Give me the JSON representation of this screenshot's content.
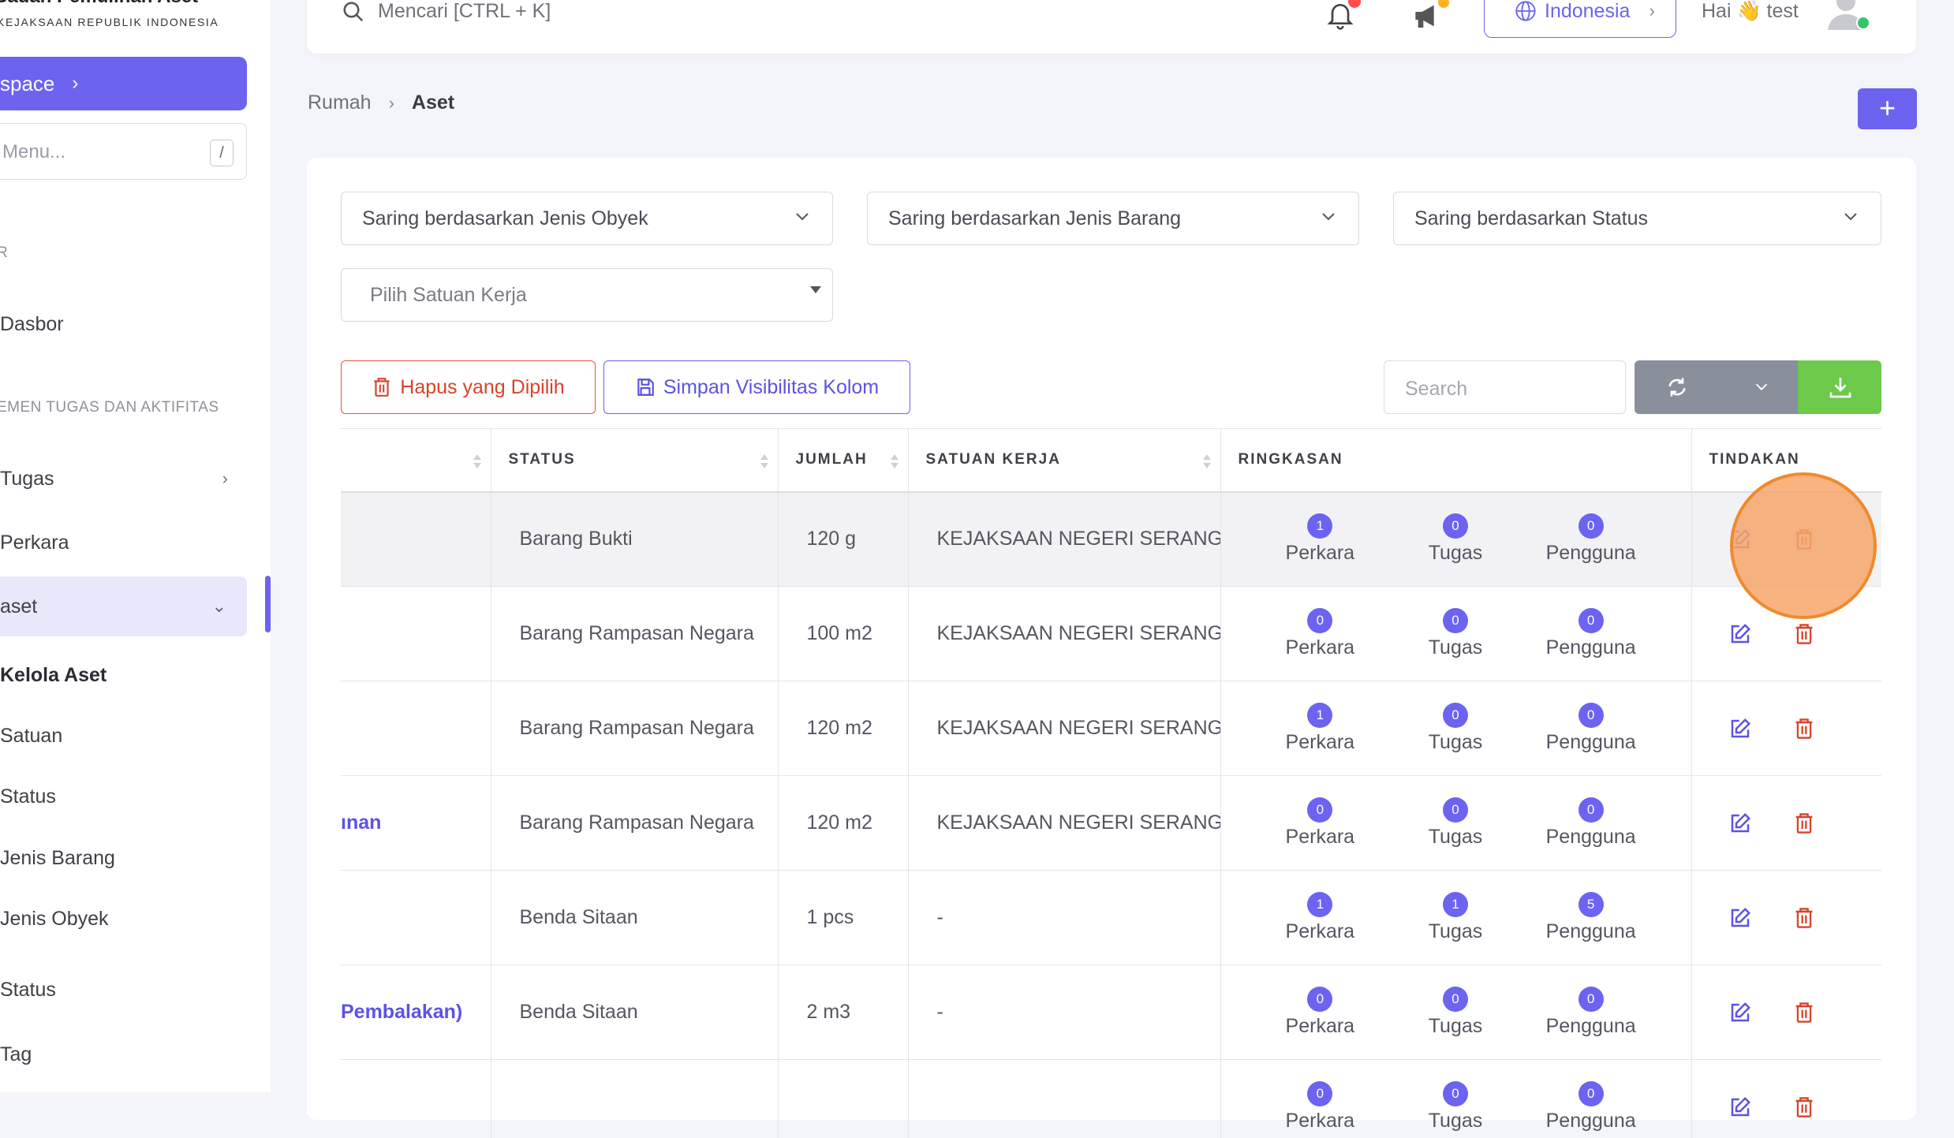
{
  "sidebar": {
    "brand_title": "Badan Pemulihan Aset",
    "brand_sub": "KEJAKSAAN REPUBLIK INDONESIA",
    "workspace_label": "space",
    "menu_search_placeholder": "Menu...",
    "menu_search_shortcut": "/",
    "section_1": "R",
    "section_2": "EMEN TUGAS DAN AKTIFITAS",
    "items": [
      {
        "label": "Dasbor"
      },
      {
        "label": "Tugas"
      },
      {
        "label": "Perkara"
      },
      {
        "label": "aset"
      },
      {
        "label": "Kelola Aset"
      },
      {
        "label": "Satuan"
      },
      {
        "label": "Status"
      },
      {
        "label": "Jenis Barang"
      },
      {
        "label": "Jenis Obyek"
      },
      {
        "label": "Status"
      },
      {
        "label": "Tag"
      }
    ]
  },
  "topbar": {
    "search_placeholder": "Mencari [CTRL + K]",
    "language": "Indonesia",
    "greeting": "Hai 👋 test"
  },
  "breadcrumb": {
    "home": "Rumah",
    "current": "Aset"
  },
  "add_label": "+",
  "filters": {
    "jenis_obyek": "Saring berdasarkan Jenis Obyek",
    "jenis_barang": "Saring berdasarkan Jenis Barang",
    "status": "Saring berdasarkan Status",
    "satuan_kerja": "Pilih Satuan Kerja"
  },
  "toolbar": {
    "delete_selected": "Hapus yang Dipilih",
    "save_columns": "Simpan Visibilitas Kolom",
    "search_placeholder": "Search"
  },
  "table": {
    "headers": {
      "status": "STATUS",
      "jumlah": "JUMLAH",
      "satuan_kerja": "SATUAN KERJA",
      "ringkasan": "RINGKASAN",
      "tindakan": "TINDAKAN"
    },
    "summary_labels": {
      "perkara": "Perkara",
      "tugas": "Tugas",
      "pengguna": "Pengguna"
    },
    "rows": [
      {
        "name": "",
        "status": "Barang Bukti",
        "jumlah": "120 g",
        "satuan_kerja": "KEJAKSAAN NEGERI SERANG",
        "perkara": "1",
        "tugas": "0",
        "pengguna": "0"
      },
      {
        "name": "",
        "status": "Barang Rampasan Negara",
        "jumlah": "100 m2",
        "satuan_kerja": "KEJAKSAAN NEGERI SERANG",
        "perkara": "0",
        "tugas": "0",
        "pengguna": "0"
      },
      {
        "name": "",
        "status": "Barang Rampasan Negara",
        "jumlah": "120 m2",
        "satuan_kerja": "KEJAKSAAN NEGERI SERANG",
        "perkara": "1",
        "tugas": "0",
        "pengguna": "0"
      },
      {
        "name": "ınan",
        "status": "Barang Rampasan Negara",
        "jumlah": "120 m2",
        "satuan_kerja": "KEJAKSAAN NEGERI SERANG",
        "perkara": "0",
        "tugas": "0",
        "pengguna": "0"
      },
      {
        "name": "",
        "status": "Benda Sitaan",
        "jumlah": "1 pcs",
        "satuan_kerja": "-",
        "perkara": "1",
        "tugas": "1",
        "pengguna": "5"
      },
      {
        "name": "Pembalakan)",
        "status": "Benda Sitaan",
        "jumlah": "2 m3",
        "satuan_kerja": "-",
        "perkara": "0",
        "tugas": "0",
        "pengguna": "0"
      },
      {
        "name": "",
        "status": "",
        "jumlah": "",
        "satuan_kerja": "",
        "perkara": "0",
        "tugas": "0",
        "pengguna": "0"
      }
    ]
  },
  "colors": {
    "accent": "#6c63f0",
    "danger": "#d8432b",
    "success": "#6cc94a",
    "highlight": "#f08a2c"
  }
}
